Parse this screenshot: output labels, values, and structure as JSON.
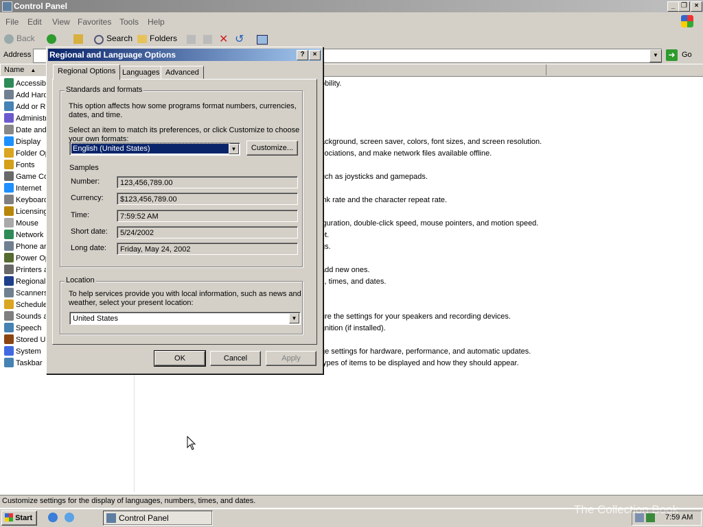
{
  "window": {
    "title": "Control Panel"
  },
  "menu": [
    "File",
    "Edit",
    "View",
    "Favorites",
    "Tools",
    "Help"
  ],
  "toolbar": {
    "back": "Back",
    "search": "Search",
    "folders": "Folders"
  },
  "address": {
    "label": "Address",
    "go": "Go"
  },
  "list": {
    "col_name": "Name",
    "items": [
      {
        "label": "Accessibi",
        "icon": "accessibility-icon",
        "color": "#2e8b57"
      },
      {
        "label": "Add Hard",
        "icon": "add-hardware-icon",
        "color": "#708090"
      },
      {
        "label": "Add or R",
        "icon": "add-remove-programs-icon",
        "color": "#4682b4"
      },
      {
        "label": "Administr",
        "icon": "administrative-tools-icon",
        "color": "#6a5acd"
      },
      {
        "label": "Date and",
        "icon": "date-time-icon",
        "color": "#888888"
      },
      {
        "label": "Display",
        "icon": "display-icon",
        "color": "#1e90ff"
      },
      {
        "label": "Folder Op",
        "icon": "folder-options-icon",
        "color": "#daa520"
      },
      {
        "label": "Fonts",
        "icon": "fonts-icon",
        "color": "#d4a017"
      },
      {
        "label": "Game Co",
        "icon": "game-controllers-icon",
        "color": "#696969"
      },
      {
        "label": "Internet",
        "icon": "internet-options-icon",
        "color": "#1e90ff"
      },
      {
        "label": "Keyboard",
        "icon": "keyboard-icon",
        "color": "#808080"
      },
      {
        "label": "Licensing",
        "icon": "licensing-icon",
        "color": "#b8860b"
      },
      {
        "label": "Mouse",
        "icon": "mouse-icon",
        "color": "#a9a9a9"
      },
      {
        "label": "Network",
        "icon": "network-connections-icon",
        "color": "#2e8b57"
      },
      {
        "label": "Phone ar",
        "icon": "phone-modem-icon",
        "color": "#708090"
      },
      {
        "label": "Power Op",
        "icon": "power-options-icon",
        "color": "#556b2f"
      },
      {
        "label": "Printers a",
        "icon": "printers-icon",
        "color": "#696969"
      },
      {
        "label": "Regional",
        "icon": "regional-options-icon",
        "color": "#1e3f8a"
      },
      {
        "label": "Scanners",
        "icon": "scanners-cameras-icon",
        "color": "#708090"
      },
      {
        "label": "Schedule",
        "icon": "scheduled-tasks-icon",
        "color": "#daa520"
      },
      {
        "label": "Sounds a",
        "icon": "sounds-audio-icon",
        "color": "#808080"
      },
      {
        "label": "Speech",
        "icon": "speech-icon",
        "color": "#4682b4"
      },
      {
        "label": "Stored U",
        "icon": "stored-user-names-icon",
        "color": "#8b4513"
      },
      {
        "label": "System",
        "icon": "system-icon",
        "color": "#4169e1"
      },
      {
        "label": "Taskbar",
        "icon": "taskbar-icon",
        "color": "#4682b4"
      }
    ],
    "descriptions": [
      "obility.",
      "ackground, screen saver, colors, font sizes, and screen resolution.",
      "sociations, and make network files available offline.",
      "uch as joysticks and gamepads.",
      ".",
      "ink rate and the character repeat rate.",
      "iguration, double-click speed, mouse pointers, and motion speed.",
      "et.",
      "gs.",
      "add new ones.",
      "s, times, and dates.",
      "ure the settings for your speakers and recording devices.",
      "gnition (if installed).",
      "ge settings for hardware, performance, and automatic updates.",
      "types of items to be displayed and how they should appear."
    ]
  },
  "dialog": {
    "title": "Regional and Language Options",
    "help_btn": "?",
    "close_btn": "×",
    "tabs": [
      "Regional Options",
      "Languages",
      "Advanced"
    ],
    "standards": {
      "group": "Standards and formats",
      "intro": "This option affects how some programs format numbers, currencies, dates, and time.",
      "select_text": "Select an item to match its preferences, or click Customize to choose your own formats:",
      "format": "English (United States)",
      "customize": "Customize...",
      "samples_label": "Samples",
      "samples": [
        {
          "label": "Number:",
          "value": "123,456,789.00"
        },
        {
          "label": "Currency:",
          "value": "$123,456,789.00"
        },
        {
          "label": "Time:",
          "value": "7:59:52 AM"
        },
        {
          "label": "Short date:",
          "value": "5/24/2002"
        },
        {
          "label": "Long date:",
          "value": "Friday, May 24, 2002"
        }
      ]
    },
    "location": {
      "group": "Location",
      "text": "To help services provide you with local information, such as news and weather, select your present location:",
      "value": "United States"
    },
    "ok": "OK",
    "cancel": "Cancel",
    "apply": "Apply"
  },
  "status": "Customize settings for the display of languages, numbers, times, and dates.",
  "taskbar": {
    "start": "Start",
    "task": "Control Panel",
    "clock": "7:59 AM",
    "watermark": "The Collection Book"
  }
}
